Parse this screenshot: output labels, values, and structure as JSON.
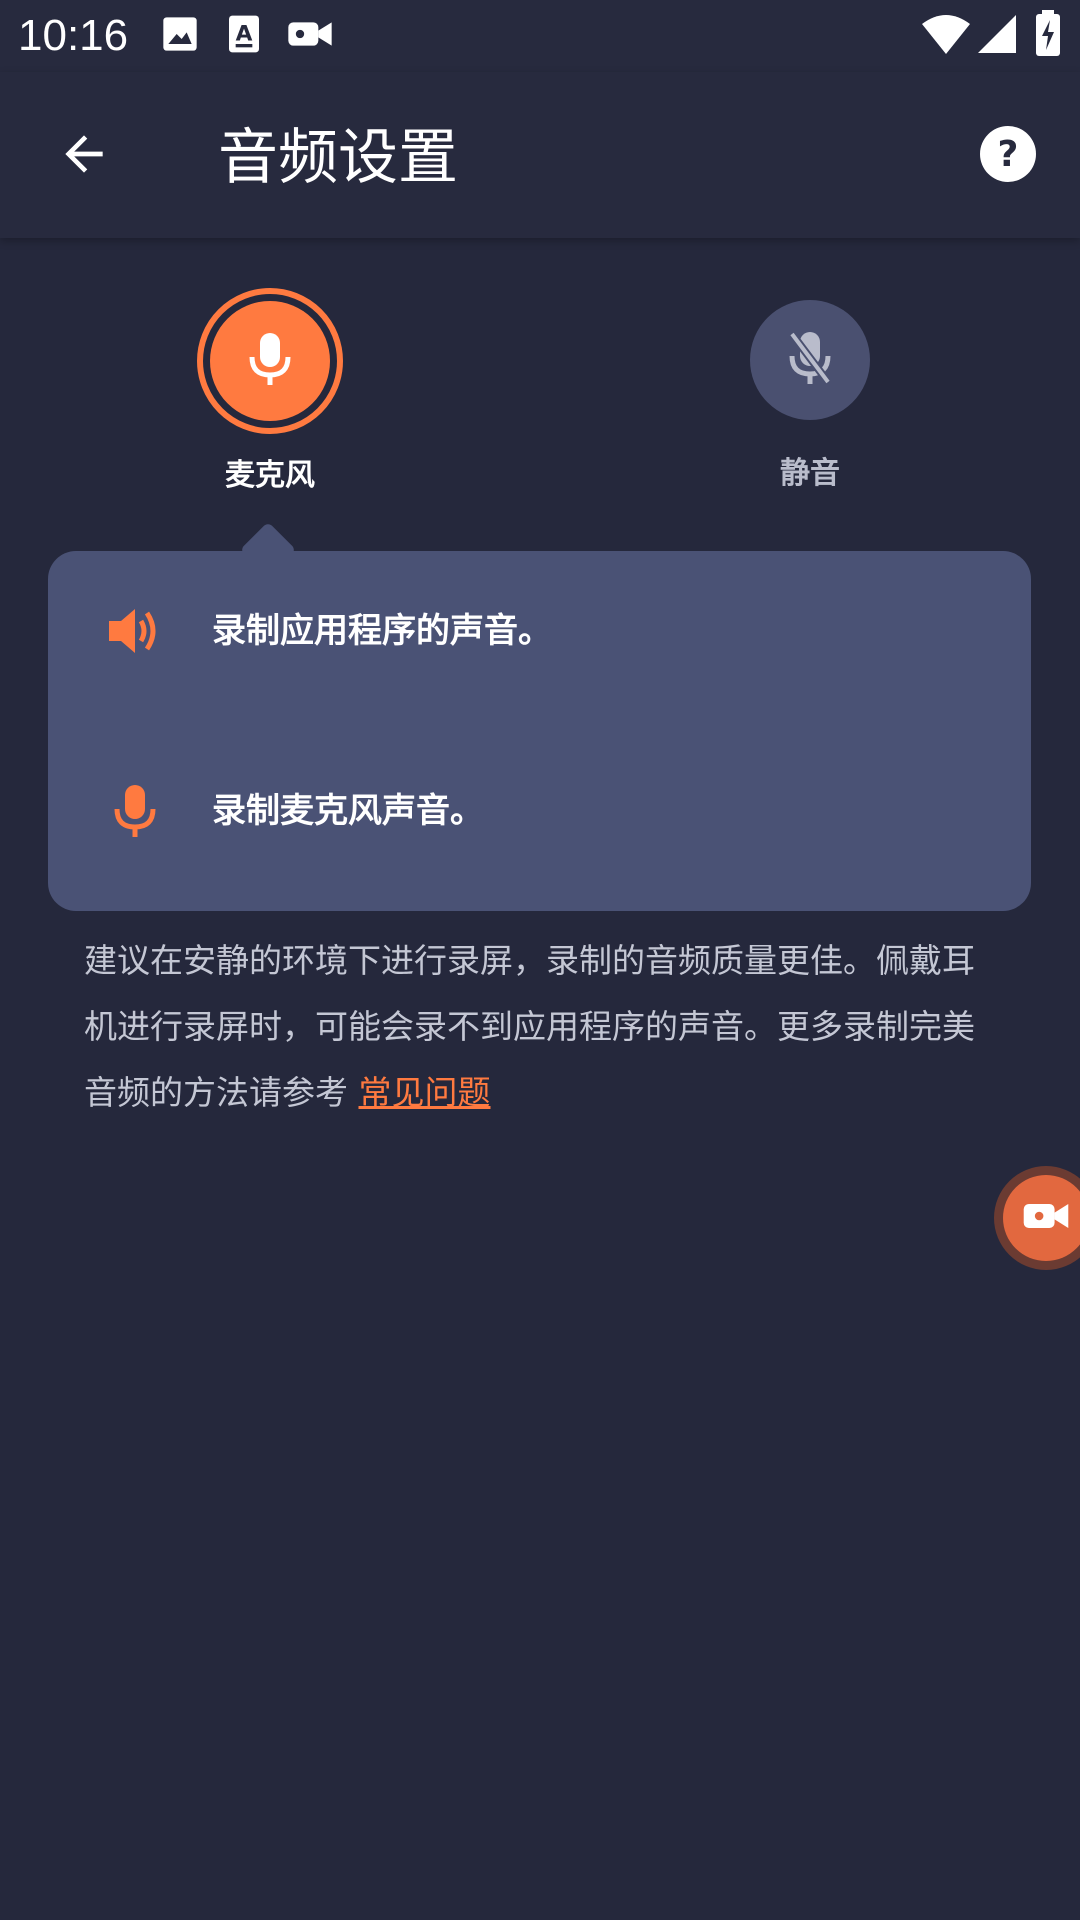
{
  "status_bar": {
    "time": "10:16",
    "left_icons": [
      "image-icon",
      "text-a-icon",
      "video-camera-icon"
    ],
    "right_icons": [
      "wifi-icon",
      "cellular-signal-icon",
      "battery-charging-icon"
    ]
  },
  "app_bar": {
    "title": "音频设置",
    "back_icon": "arrow-left-icon",
    "help_icon": "help-icon",
    "help_symbol": "?"
  },
  "options": {
    "microphone": {
      "label": "麦克风",
      "icon": "microphone-icon",
      "selected": true
    },
    "mute": {
      "label": "静音",
      "icon": "microphone-off-icon",
      "selected": false
    }
  },
  "info_card": {
    "rows": [
      {
        "icon": "speaker-icon",
        "text": "录制应用程序的声音。"
      },
      {
        "icon": "microphone-icon",
        "text": "录制麦克风声音。"
      }
    ]
  },
  "description": {
    "text": "建议在安静的环境下进行录屏，录制的音频质量更佳。佩戴耳机进行录屏时，可能会录不到应用程序的声音。更多录制完美音频的方法请参考 ",
    "link_text": "常见问题"
  },
  "floating_button": {
    "icon": "record-camera-icon"
  },
  "colors": {
    "background": "#25283c",
    "accent": "#ff7a40",
    "card": "#4a5275",
    "mute_circle": "#4a5070"
  }
}
